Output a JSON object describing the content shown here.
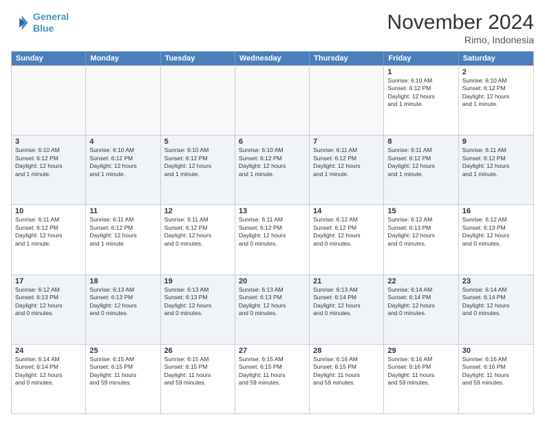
{
  "header": {
    "logo_line1": "General",
    "logo_line2": "Blue",
    "month_title": "November 2024",
    "location": "Rimo, Indonesia"
  },
  "weekdays": [
    "Sunday",
    "Monday",
    "Tuesday",
    "Wednesday",
    "Thursday",
    "Friday",
    "Saturday"
  ],
  "rows": [
    [
      {
        "day": "",
        "info": ""
      },
      {
        "day": "",
        "info": ""
      },
      {
        "day": "",
        "info": ""
      },
      {
        "day": "",
        "info": ""
      },
      {
        "day": "",
        "info": ""
      },
      {
        "day": "1",
        "info": "Sunrise: 6:10 AM\nSunset: 6:12 PM\nDaylight: 12 hours\nand 1 minute."
      },
      {
        "day": "2",
        "info": "Sunrise: 6:10 AM\nSunset: 6:12 PM\nDaylight: 12 hours\nand 1 minute."
      }
    ],
    [
      {
        "day": "3",
        "info": "Sunrise: 6:10 AM\nSunset: 6:12 PM\nDaylight: 12 hours\nand 1 minute."
      },
      {
        "day": "4",
        "info": "Sunrise: 6:10 AM\nSunset: 6:12 PM\nDaylight: 12 hours\nand 1 minute."
      },
      {
        "day": "5",
        "info": "Sunrise: 6:10 AM\nSunset: 6:12 PM\nDaylight: 12 hours\nand 1 minute."
      },
      {
        "day": "6",
        "info": "Sunrise: 6:10 AM\nSunset: 6:12 PM\nDaylight: 12 hours\nand 1 minute."
      },
      {
        "day": "7",
        "info": "Sunrise: 6:11 AM\nSunset: 6:12 PM\nDaylight: 12 hours\nand 1 minute."
      },
      {
        "day": "8",
        "info": "Sunrise: 6:11 AM\nSunset: 6:12 PM\nDaylight: 12 hours\nand 1 minute."
      },
      {
        "day": "9",
        "info": "Sunrise: 6:11 AM\nSunset: 6:12 PM\nDaylight: 12 hours\nand 1 minute."
      }
    ],
    [
      {
        "day": "10",
        "info": "Sunrise: 6:11 AM\nSunset: 6:12 PM\nDaylight: 12 hours\nand 1 minute."
      },
      {
        "day": "11",
        "info": "Sunrise: 6:11 AM\nSunset: 6:12 PM\nDaylight: 12 hours\nand 1 minute."
      },
      {
        "day": "12",
        "info": "Sunrise: 6:11 AM\nSunset: 6:12 PM\nDaylight: 12 hours\nand 0 minutes."
      },
      {
        "day": "13",
        "info": "Sunrise: 6:11 AM\nSunset: 6:12 PM\nDaylight: 12 hours\nand 0 minutes."
      },
      {
        "day": "14",
        "info": "Sunrise: 6:12 AM\nSunset: 6:12 PM\nDaylight: 12 hours\nand 0 minutes."
      },
      {
        "day": "15",
        "info": "Sunrise: 6:12 AM\nSunset: 6:13 PM\nDaylight: 12 hours\nand 0 minutes."
      },
      {
        "day": "16",
        "info": "Sunrise: 6:12 AM\nSunset: 6:13 PM\nDaylight: 12 hours\nand 0 minutes."
      }
    ],
    [
      {
        "day": "17",
        "info": "Sunrise: 6:12 AM\nSunset: 6:13 PM\nDaylight: 12 hours\nand 0 minutes."
      },
      {
        "day": "18",
        "info": "Sunrise: 6:13 AM\nSunset: 6:13 PM\nDaylight: 12 hours\nand 0 minutes."
      },
      {
        "day": "19",
        "info": "Sunrise: 6:13 AM\nSunset: 6:13 PM\nDaylight: 12 hours\nand 0 minutes."
      },
      {
        "day": "20",
        "info": "Sunrise: 6:13 AM\nSunset: 6:13 PM\nDaylight: 12 hours\nand 0 minutes."
      },
      {
        "day": "21",
        "info": "Sunrise: 6:13 AM\nSunset: 6:14 PM\nDaylight: 12 hours\nand 0 minutes."
      },
      {
        "day": "22",
        "info": "Sunrise: 6:14 AM\nSunset: 6:14 PM\nDaylight: 12 hours\nand 0 minutes."
      },
      {
        "day": "23",
        "info": "Sunrise: 6:14 AM\nSunset: 6:14 PM\nDaylight: 12 hours\nand 0 minutes."
      }
    ],
    [
      {
        "day": "24",
        "info": "Sunrise: 6:14 AM\nSunset: 6:14 PM\nDaylight: 12 hours\nand 0 minutes."
      },
      {
        "day": "25",
        "info": "Sunrise: 6:15 AM\nSunset: 6:15 PM\nDaylight: 11 hours\nand 59 minutes."
      },
      {
        "day": "26",
        "info": "Sunrise: 6:15 AM\nSunset: 6:15 PM\nDaylight: 11 hours\nand 59 minutes."
      },
      {
        "day": "27",
        "info": "Sunrise: 6:15 AM\nSunset: 6:15 PM\nDaylight: 11 hours\nand 59 minutes."
      },
      {
        "day": "28",
        "info": "Sunrise: 6:16 AM\nSunset: 6:15 PM\nDaylight: 11 hours\nand 59 minutes."
      },
      {
        "day": "29",
        "info": "Sunrise: 6:16 AM\nSunset: 6:16 PM\nDaylight: 11 hours\nand 59 minutes."
      },
      {
        "day": "30",
        "info": "Sunrise: 6:16 AM\nSunset: 6:16 PM\nDaylight: 11 hours\nand 59 minutes."
      }
    ]
  ]
}
